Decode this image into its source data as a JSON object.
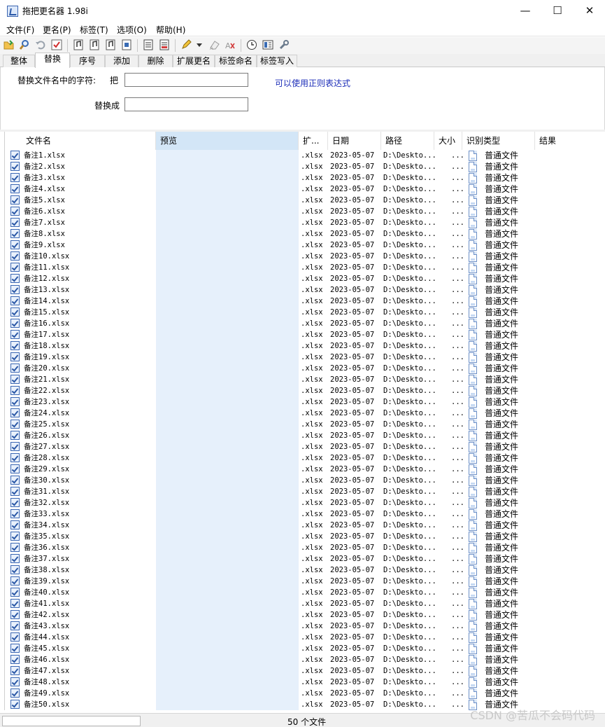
{
  "window": {
    "title": "拖把更名器 1.98i",
    "minimize": "—",
    "maximize": "☐",
    "close": "✕"
  },
  "menu": [
    "文件(F)",
    "更名(P)",
    "标签(T)",
    "选项(O)",
    "帮助(H)"
  ],
  "toolbar_icons": [
    "open-folder-icon",
    "search-icon",
    "undo-icon",
    "checklist-icon",
    "music-tag-icon",
    "music-tag-icon",
    "music-tag-icon",
    "id3-icon",
    "document-icon",
    "report-icon",
    "highlighter-icon",
    "dropdown-arrow-icon",
    "eraser-icon",
    "clear-icon",
    "clock-icon",
    "panel-icon",
    "settings-icon"
  ],
  "tabs": [
    "整体",
    "替换",
    "序号",
    "添加",
    "删除",
    "扩展更名",
    "标签命名",
    "标签写入"
  ],
  "active_tab": "替换",
  "replace_panel": {
    "find_label": "替换文件名中的字符:",
    "find_prefix": "把",
    "find_value": "",
    "replace_label": "替换成",
    "replace_value": "",
    "regex_hint": "可以使用正则表达式"
  },
  "columns": [
    "文件名",
    "预览",
    "扩...",
    "日期",
    "路径",
    "大小",
    "识别类型",
    "结果"
  ],
  "files": {
    "prefix": "备注",
    "suffix": ".xlsx",
    "count": 50,
    "ext": ".xlsx",
    "date": "2023-05-07",
    "path": "D:\\Deskto...",
    "size": "...",
    "type": "普通文件"
  },
  "status": {
    "file_count": "50 个文件"
  },
  "watermark": "CSDN @苦瓜不会码代码"
}
